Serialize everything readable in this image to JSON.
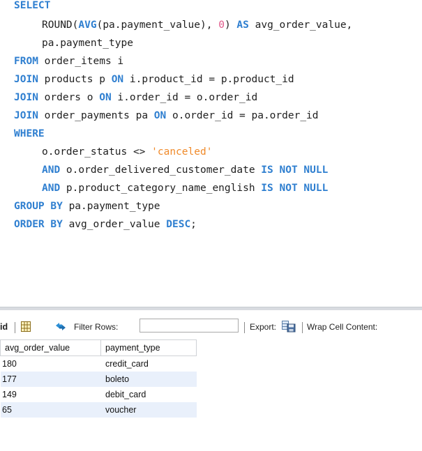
{
  "sql": {
    "line1": "SELECT",
    "line2_fn1": "ROUND(",
    "line2_fn2": "AVG",
    "line2_rest": "(pa.payment_value), ",
    "line2_num": "0",
    "line2_close": ") ",
    "line2_as": "AS",
    "line2_alias": " avg_order_value,",
    "line3": "pa.payment_type",
    "line4_kw": "FROM",
    "line4_rest": " order_items i",
    "line5_kw": "JOIN",
    "line5_mid": " products p ",
    "line5_on": "ON",
    "line5_rest": " i.product_id = p.product_id",
    "line6_kw": "JOIN",
    "line6_mid": " orders o ",
    "line6_on": "ON",
    "line6_rest": " i.order_id = o.order_id",
    "line7_kw": "JOIN",
    "line7_mid": " order_payments pa ",
    "line7_on": "ON",
    "line7_rest": " o.order_id = pa.order_id",
    "line8": "WHERE",
    "line9_plain": "o.order_status <> ",
    "line9_str": "'canceled'",
    "line10_and": "AND",
    "line10_rest": " o.order_delivered_customer_date ",
    "line10_kw": "IS NOT NULL",
    "line11_and": "AND",
    "line11_rest": " p.product_category_name_english ",
    "line11_kw": "IS NOT NULL",
    "line12_kw": "GROUP BY",
    "line12_rest": " pa.payment_type",
    "line13_kw": "ORDER BY",
    "line13_rest": " avg_order_value ",
    "line13_desc": "DESC",
    "line13_end": ";"
  },
  "toolbar": {
    "grid_label": "id",
    "filter_label": "Filter Rows:",
    "filter_value": "",
    "export_label": "Export:",
    "wrap_label": "Wrap Cell Content:"
  },
  "results": {
    "columns": [
      "avg_order_value",
      "payment_type"
    ],
    "rows": [
      [
        "180",
        "credit_card"
      ],
      [
        "177",
        "boleto"
      ],
      [
        "149",
        "debit_card"
      ],
      [
        "65",
        "voucher"
      ]
    ]
  },
  "colors": {
    "keyword": "#2f7fd0",
    "number": "#e0588a",
    "string": "#f08a2a",
    "row_alt": "#e9f0fb"
  }
}
